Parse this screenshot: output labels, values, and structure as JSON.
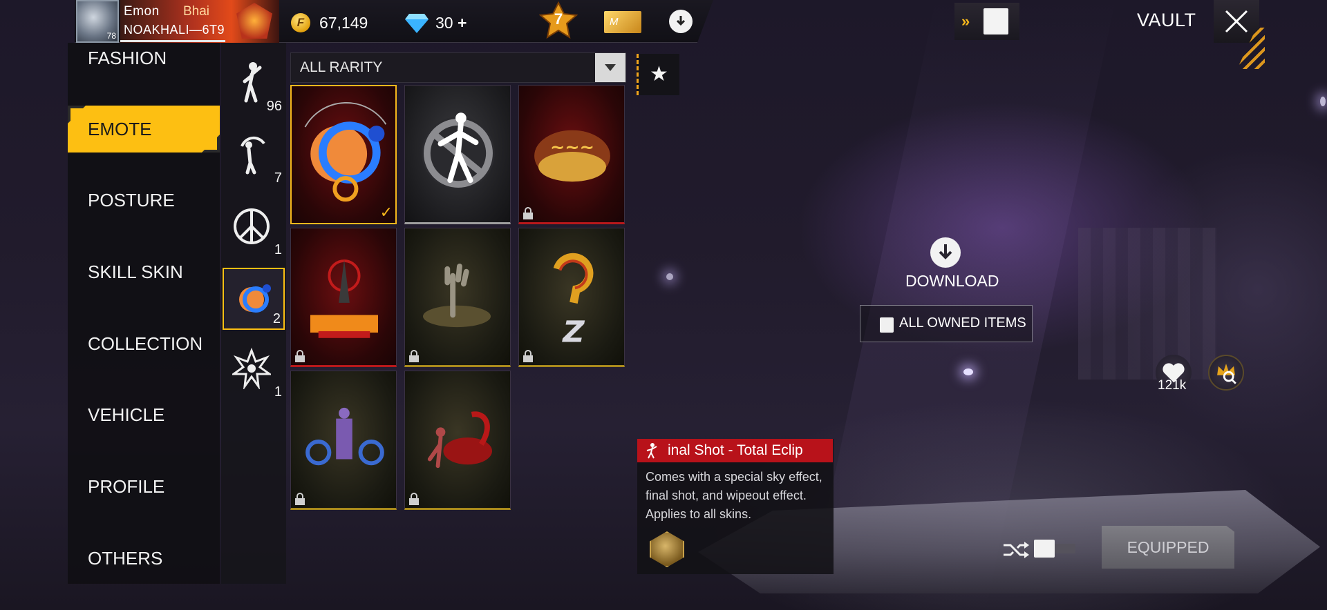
{
  "header": {
    "player_name": "Emon",
    "player_tag": "Bhai",
    "player_guild": "NOAKHALI—6T9",
    "avatar_level": "78",
    "gold_amount": "67,149",
    "gold_icon_letter": "F",
    "diamond_amount": "30",
    "diamond_plus": "+",
    "rank_number": "7",
    "membership_letter": "M",
    "page_title": "VAULT"
  },
  "nav": {
    "items": [
      {
        "label": "FASHION"
      },
      {
        "label": "EMOTE"
      },
      {
        "label": "POSTURE"
      },
      {
        "label": "SKILL SKIN"
      },
      {
        "label": "COLLECTION"
      },
      {
        "label": "VEHICLE"
      },
      {
        "label": "PROFILE"
      },
      {
        "label": "OTHERS"
      }
    ],
    "active": "EMOTE"
  },
  "subcategories": [
    {
      "count": "96",
      "icon": "dance-pose-icon"
    },
    {
      "count": "7",
      "icon": "acrobat-pose-icon"
    },
    {
      "count": "1",
      "icon": "peace-circle-emote-icon"
    },
    {
      "count": "2",
      "icon": "eclipse-emote-icon",
      "active": true
    },
    {
      "count": "1",
      "icon": "explosion-emote-icon"
    }
  ],
  "filter": {
    "rarity_label": "ALL RARITY"
  },
  "grid": [
    {
      "name": "emote-total-eclipse",
      "rarity": "red",
      "locked": false,
      "selected": true
    },
    {
      "name": "emote-no-shot",
      "rarity": "grey",
      "locked": false,
      "selected": false
    },
    {
      "name": "emote-treasure",
      "rarity": "red",
      "locked": true,
      "selected": false
    },
    {
      "name": "emote-naruto",
      "rarity": "red",
      "locked": true,
      "selected": false
    },
    {
      "name": "emote-zombie-hand",
      "rarity": "gold",
      "locked": true,
      "selected": false
    },
    {
      "name": "emote-question-z",
      "rarity": "gold",
      "locked": true,
      "selected": false
    },
    {
      "name": "emote-blue-bike",
      "rarity": "gold",
      "locked": true,
      "selected": false
    },
    {
      "name": "emote-scorpion",
      "rarity": "gold",
      "locked": true,
      "selected": false
    }
  ],
  "center": {
    "download_label": "DOWNLOAD",
    "owned_items_label": "ALL OWNED ITEMS"
  },
  "social": {
    "like_count": "121k"
  },
  "details": {
    "title": "inal Shot - Total Eclip",
    "description": "Comes with a special sky effect, final shot, and wipeout effect. Applies to all skins."
  },
  "actions": {
    "equip_label": "EQUIPPED"
  },
  "colors": {
    "accent": "#fdbf12",
    "rarity_red": "#b8181b",
    "rarity_gold": "#a98a1c"
  }
}
